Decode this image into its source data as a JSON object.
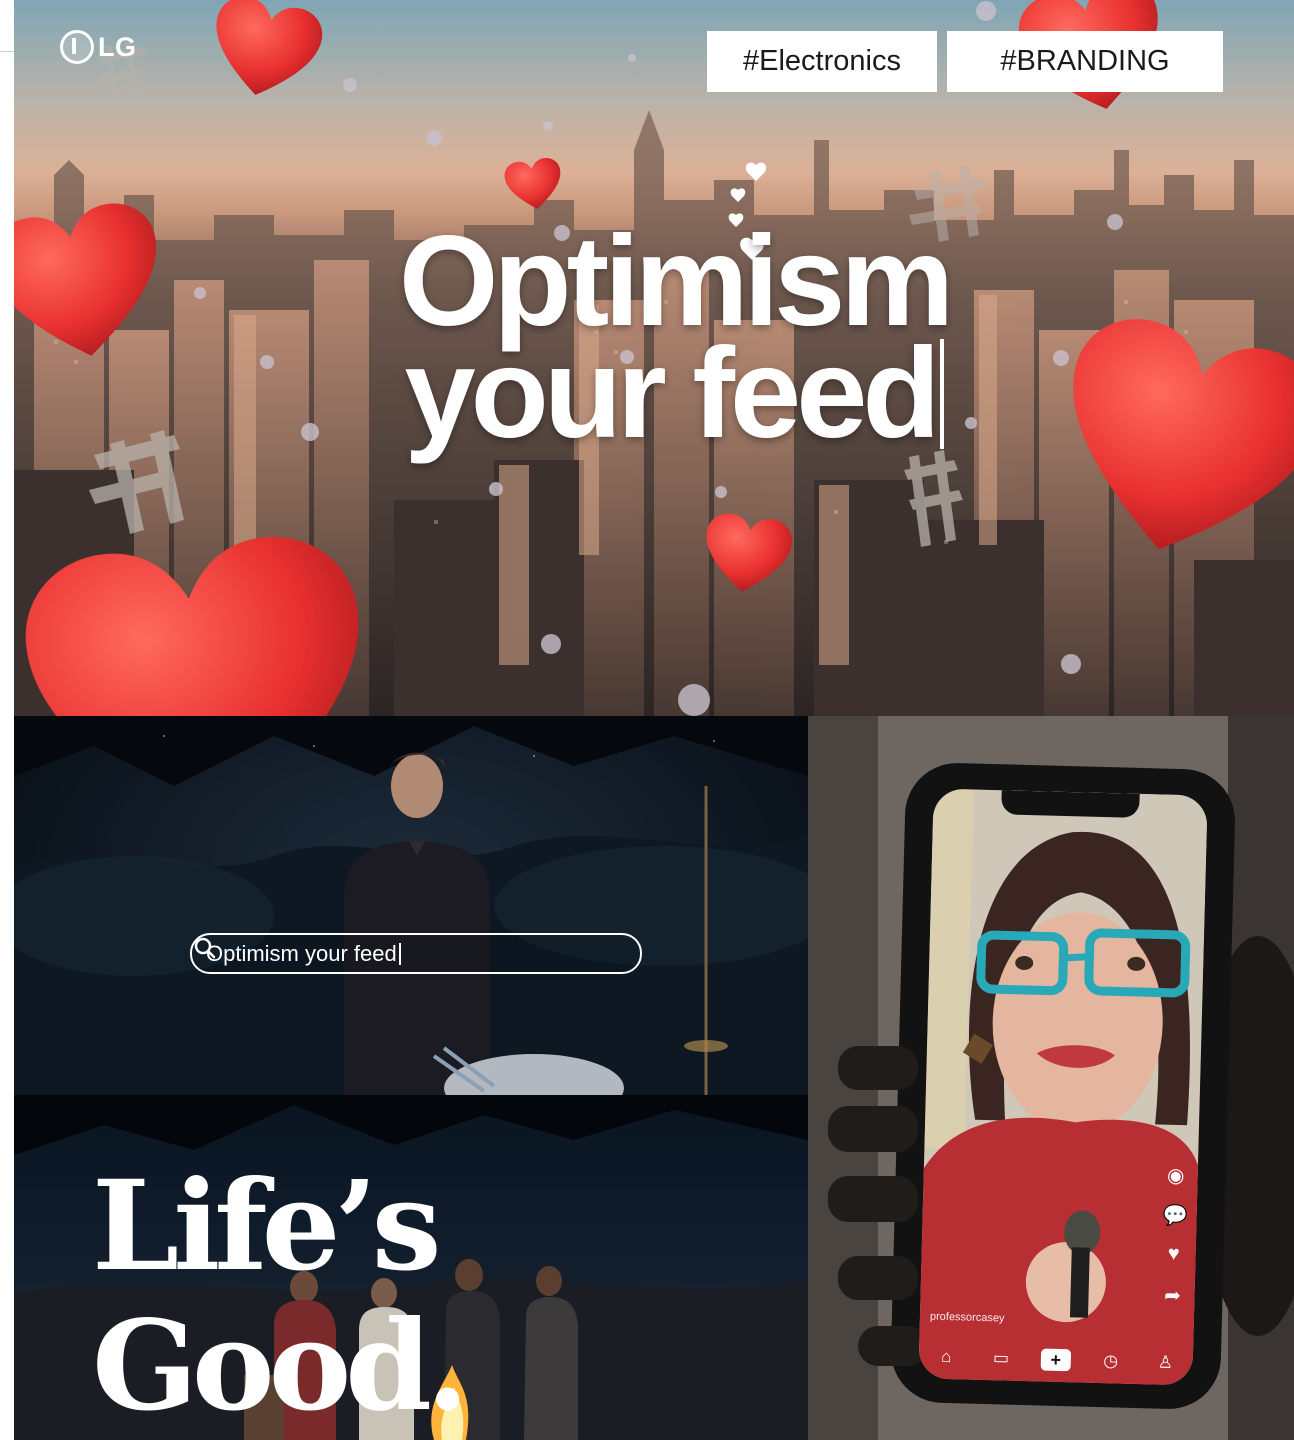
{
  "brand": {
    "logo_text": "LG"
  },
  "tags": [
    {
      "label": "#Electronics"
    },
    {
      "label": "#BRANDING"
    }
  ],
  "hero": {
    "headline_line1": "Optimism",
    "headline_line2": "your feed"
  },
  "search": {
    "query": "Optimism your feed"
  },
  "tagline": {
    "text": "Life’s Good."
  },
  "phone": {
    "username": "professorcasey",
    "side_icons": [
      "avatar-icon",
      "comment-icon",
      "heart-icon",
      "share-icon"
    ],
    "tab_icons": [
      "home-icon",
      "inbox-icon",
      "create-icon",
      "discover-icon",
      "profile-icon"
    ]
  },
  "colors": {
    "heart": "#e8302f",
    "tag_bg": "#ffffff",
    "headline": "#ffffff",
    "shirt_red": "#b72e33",
    "glasses": "#29a9b8"
  }
}
